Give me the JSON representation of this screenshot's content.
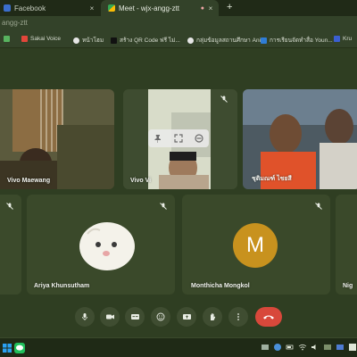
{
  "browser": {
    "tabs": [
      {
        "label": "Facebook",
        "close": "×"
      },
      {
        "label": "Meet - wjx-angg-ztt",
        "close": "×",
        "active": true
      }
    ],
    "new_tab": "+",
    "url": "angg-ztt"
  },
  "bookmarks": [
    {
      "label": "Sakai Voice",
      "icon": "bookmark-icon-1"
    },
    {
      "label": "หน้าโฮม",
      "icon": "bookmark-icon-2"
    },
    {
      "label": "สร้าง QR Code ฟรี ไม่...",
      "icon": "bookmark-icon-3"
    },
    {
      "label": "กลุ่มข้อมูลสถานศึกษา Ani...",
      "icon": "bookmark-icon-4"
    },
    {
      "label": "คู่มือ Exam...",
      "icon": "bookmark-icon-5"
    },
    {
      "label": "การเรียนจัดทำสื่อ Youn...",
      "icon": "bookmark-icon-6"
    },
    {
      "label": "Kru",
      "icon": "bookmark-icon-7"
    }
  ],
  "participants": [
    {
      "name": "Vivo Maewang",
      "muted": true
    },
    {
      "name": "Vivo Vi",
      "muted": true
    },
    {
      "name": "ชุติมณฑ์ ไชยสี",
      "muted": true
    },
    {
      "name": "",
      "muted": true
    },
    {
      "name": "Ariya Khunsutham",
      "muted": true
    },
    {
      "name": "Monthicha Mongkol",
      "muted": true,
      "avatar_letter": "M",
      "avatar_color": "#c8921e"
    },
    {
      "name": "Nig",
      "muted": true
    }
  ],
  "controls": {
    "items": [
      "mic-icon",
      "camera-icon",
      "captions-icon",
      "emoji-icon",
      "present-icon",
      "raise-hand-icon",
      "more-icon",
      "hang-up-icon"
    ],
    "end_color": "#d8483b"
  },
  "colors": {
    "background": "#2f3e22",
    "tile": "#3b4a2b",
    "accent": "#c8921e"
  }
}
